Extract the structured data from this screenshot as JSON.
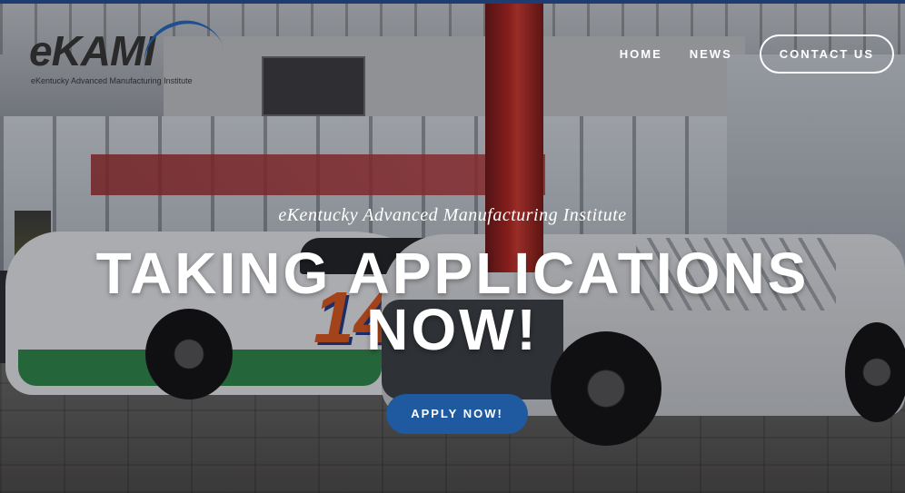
{
  "logo": {
    "wordmark": "eKAMI",
    "subtitle": "eKentucky Advanced Manufacturing Institute"
  },
  "nav": {
    "items": [
      {
        "label": "HOME"
      },
      {
        "label": "NEWS"
      }
    ],
    "contact_label": "CONTACT US"
  },
  "hero": {
    "subtitle": "eKentucky Advanced Manufacturing Institute",
    "title_line1": "TAKING APPLICATIONS",
    "title_line2": "NOW!",
    "cta_label": "APPLY NOW!"
  },
  "scene": {
    "car_number": "14"
  },
  "colors": {
    "accent": "#1f5aa0",
    "topbar": "#1f3c72",
    "logo_swoosh": "#1e4f8f"
  }
}
